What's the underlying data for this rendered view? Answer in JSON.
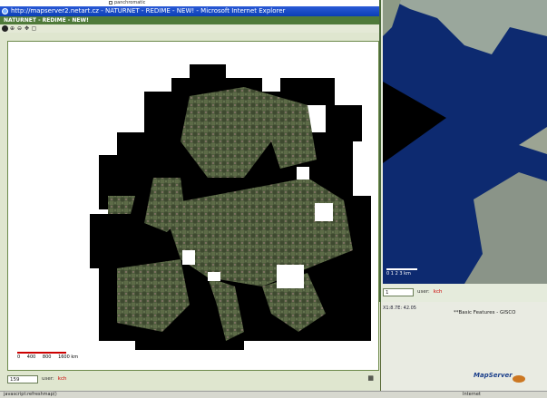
{
  "background": {
    "tree_item": "panchromatic"
  },
  "window": {
    "title": "http://mapserver2.netart.cz - NATURNET - REDIME - NEW! - Microsoft Internet Explorer",
    "app_header": "NATURNET - REDIME - NEW!"
  },
  "map_main": {
    "scale_labels": [
      "0",
      "400",
      "800",
      "1600 km"
    ],
    "scale_input_value": "159",
    "user_label": "user:",
    "user_value": "kch"
  },
  "map_right": {
    "scale_labels": [
      "0",
      "1",
      "2",
      "3 km"
    ],
    "scale_input_value": "1",
    "user_label": "user:",
    "user_value": "kch",
    "coords": "X1:8.7E: 42.05"
  },
  "features_label": "**Basic Features - GISCO",
  "logo_text": "MapServer",
  "statusbar": {
    "left_text": "javascript:refreshmap()",
    "right_text": "Internet"
  },
  "colors": {
    "title_bar": "#0b3fb5",
    "app_header": "#4f7a3a",
    "frame_border": "#6d8a4b",
    "user_value": "#cc0000",
    "sea": "#0d2a70"
  }
}
